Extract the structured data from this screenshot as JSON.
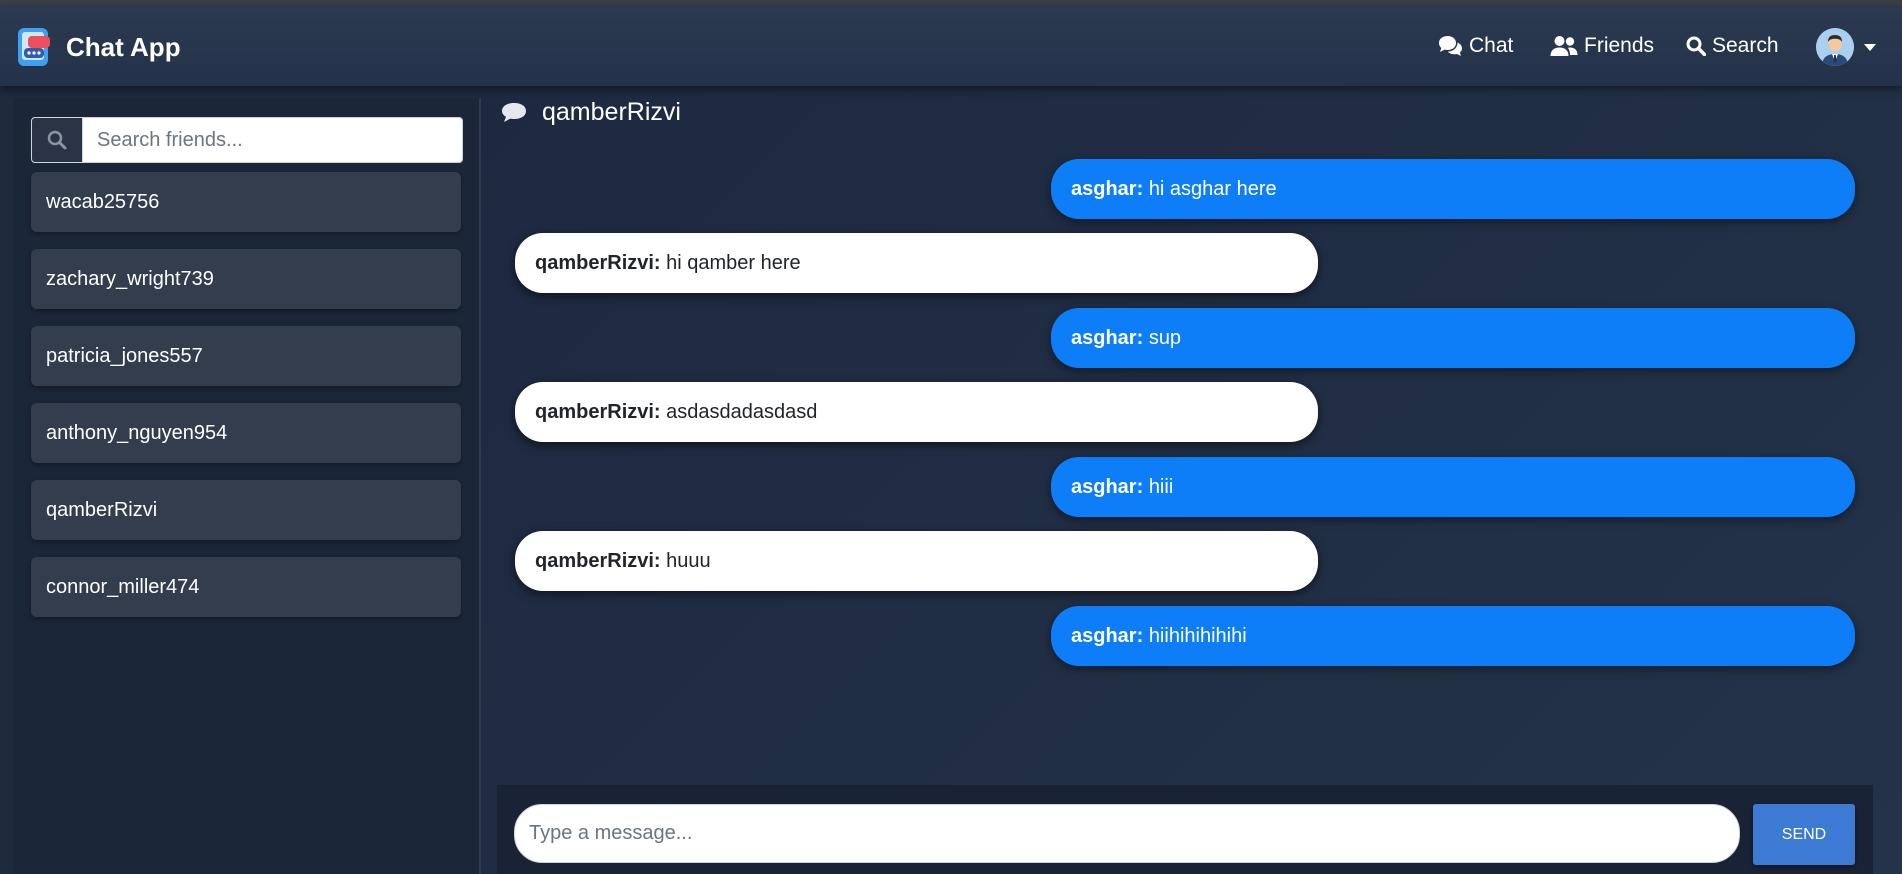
{
  "app": {
    "title": "Chat App"
  },
  "nav": {
    "chat_label": "Chat",
    "friends_label": "Friends",
    "search_label": "Search"
  },
  "sidebar": {
    "search_placeholder": "Search friends...",
    "friends": [
      "wacab25756",
      "zachary_wright739",
      "patricia_jones557",
      "anthony_nguyen954",
      "qamberRizvi",
      "connor_miller474"
    ]
  },
  "chat": {
    "header_name": "qamberRizvi",
    "messages": [
      {
        "sender": "asghar:",
        "text": "hi asghar here",
        "outgoing": true
      },
      {
        "sender": "qamberRizvi:",
        "text": "hi qamber here",
        "outgoing": false
      },
      {
        "sender": "asghar:",
        "text": "sup",
        "outgoing": true
      },
      {
        "sender": "qamberRizvi:",
        "text": "asdasdadasdasd",
        "outgoing": false
      },
      {
        "sender": "asghar:",
        "text": "hiii",
        "outgoing": true
      },
      {
        "sender": "qamberRizvi:",
        "text": "huuu",
        "outgoing": false
      },
      {
        "sender": "asghar:",
        "text": "hiihihihihihi",
        "outgoing": true
      }
    ]
  },
  "composer": {
    "placeholder": "Type a message...",
    "send_label": "SEND"
  },
  "colors": {
    "accent": "#0d7ef8",
    "send_button": "#3c7ad4",
    "navbar": "#2b3a50"
  },
  "icons": {
    "brand": "chat-app-logo",
    "chat": "comments-icon",
    "friends": "users-icon",
    "search": "search-icon",
    "chat_header": "comment-icon"
  }
}
